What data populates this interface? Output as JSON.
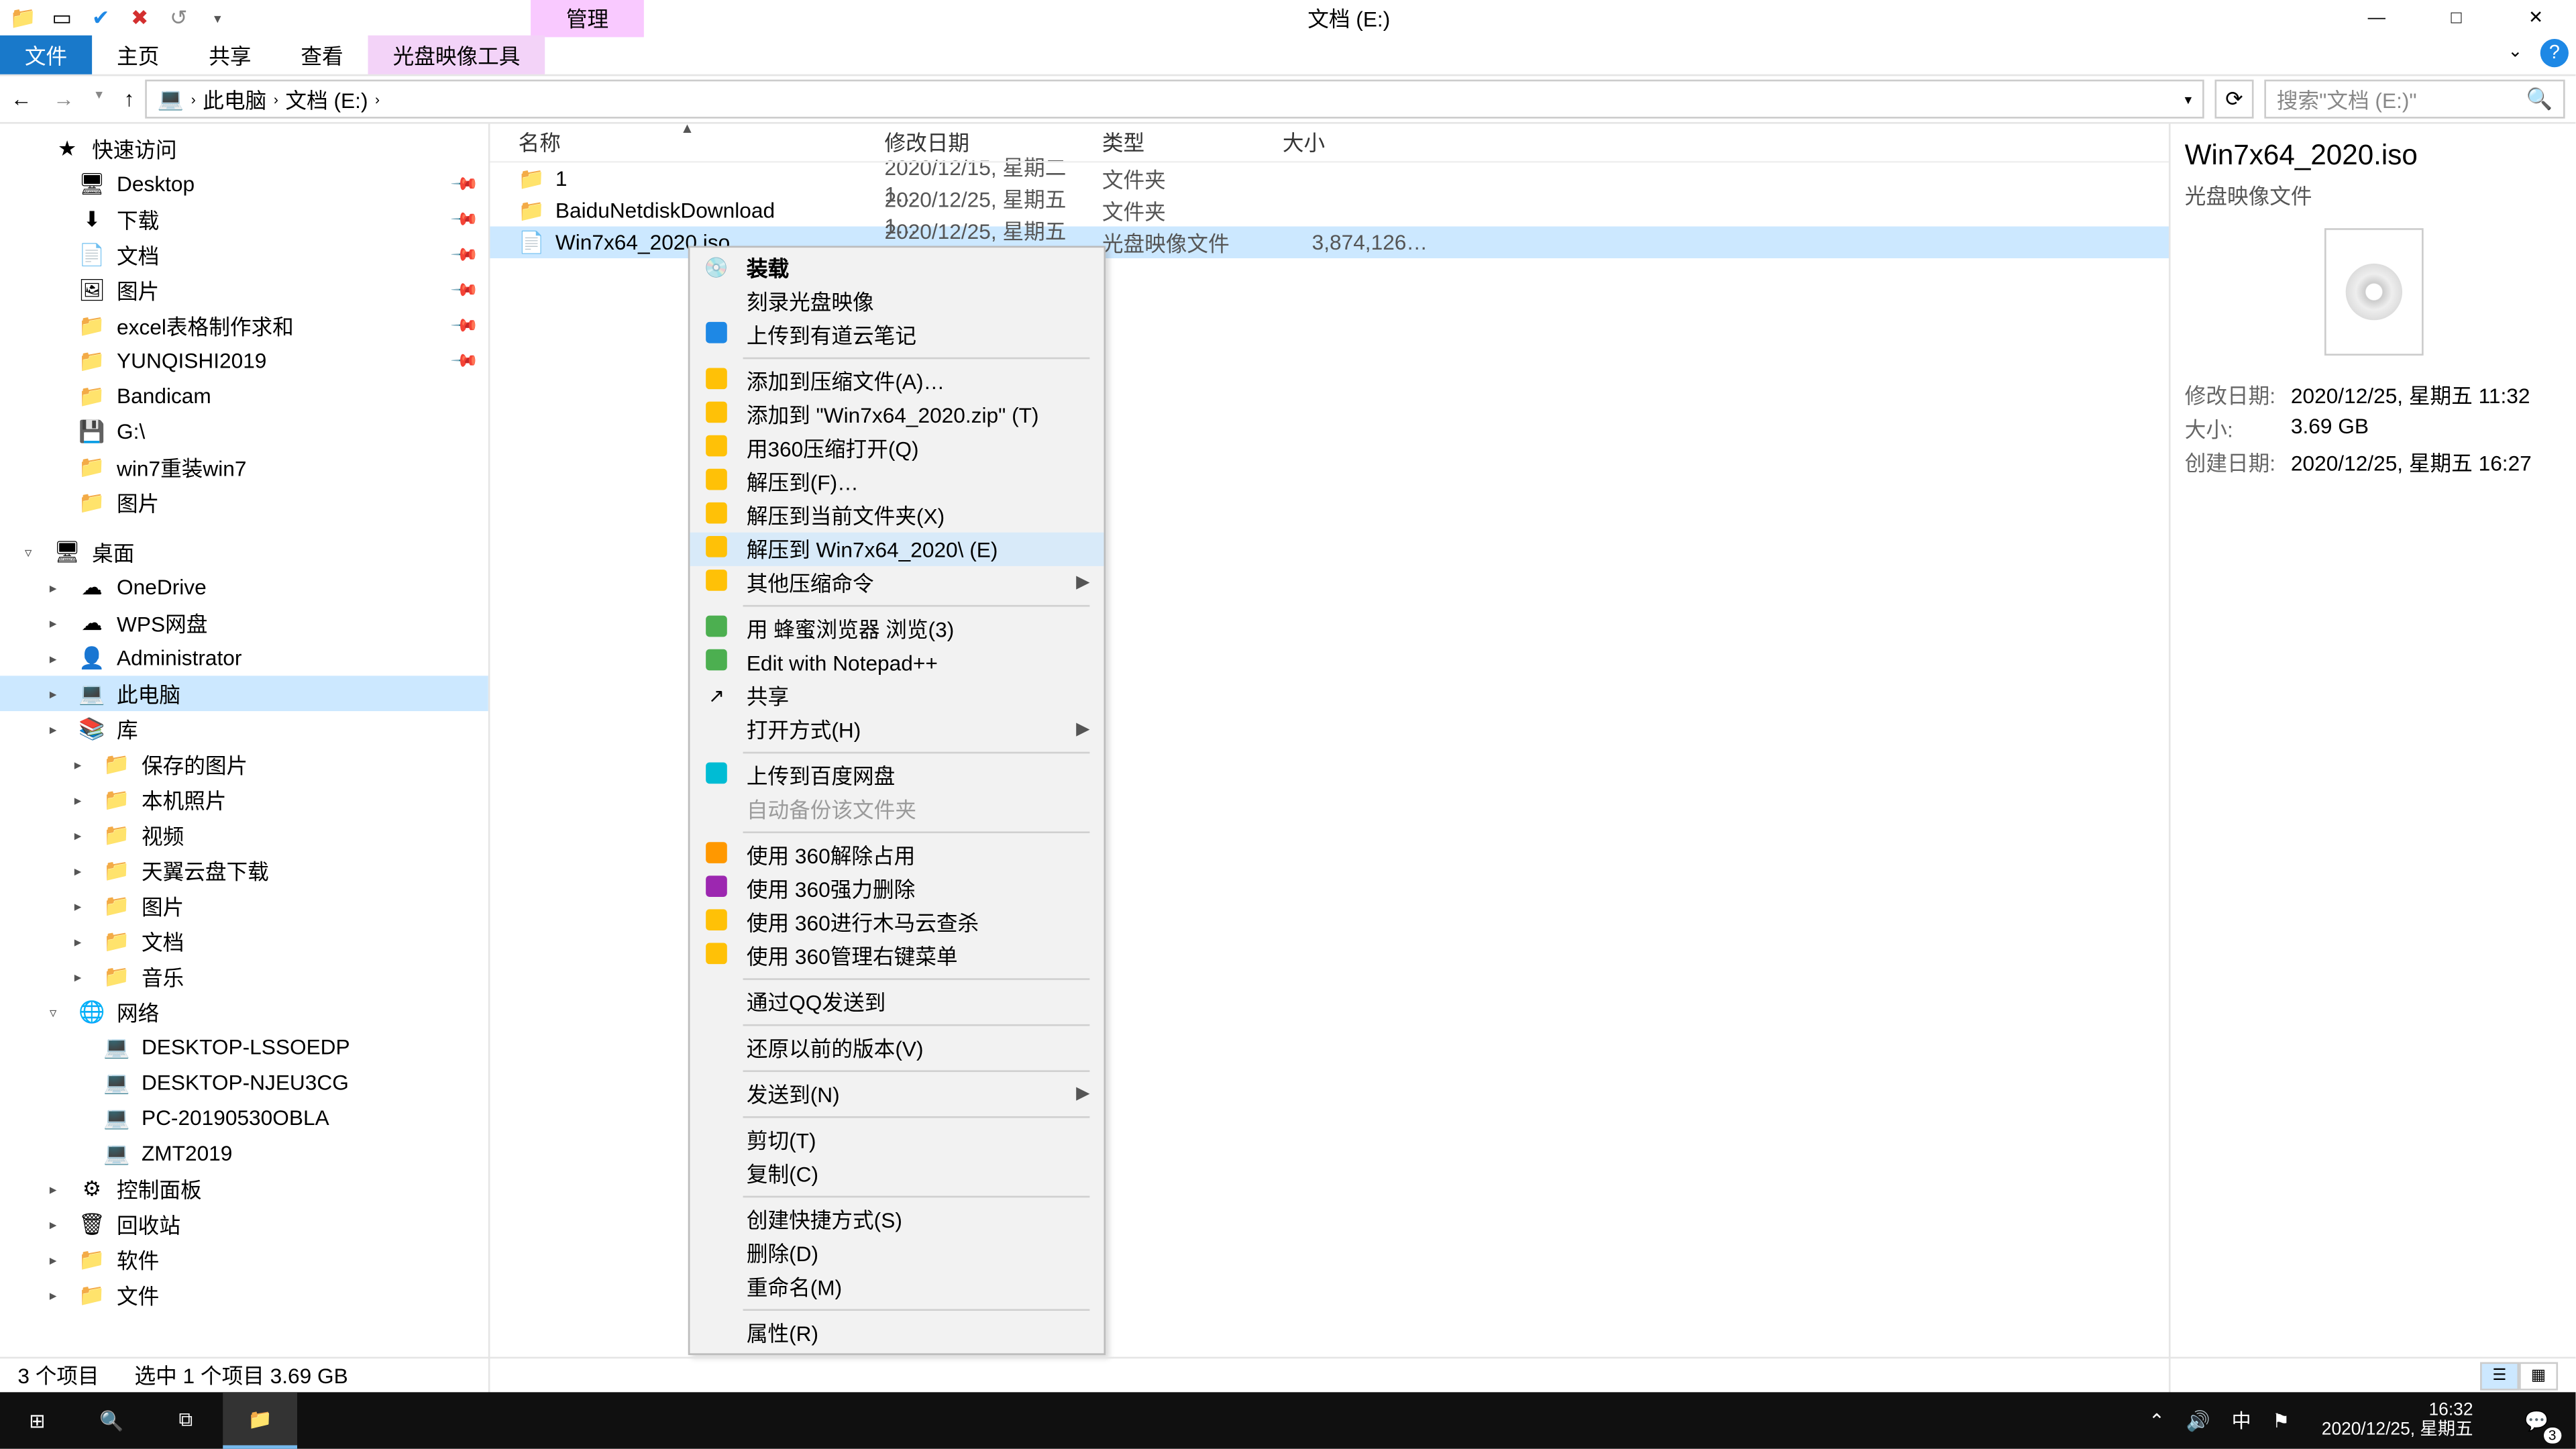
{
  "window": {
    "title": "文档 (E:)",
    "context_tab": "管理",
    "minimize": "—",
    "maximize": "□",
    "close": "✕"
  },
  "ribbon": {
    "file": "文件",
    "tabs": [
      "主页",
      "共享",
      "查看"
    ],
    "context": "光盘映像工具"
  },
  "nav": {
    "back": "←",
    "forward": "→",
    "up": "↑",
    "crumbs": [
      "此电脑",
      "文档 (E:)"
    ],
    "search_placeholder": "搜索\"文档 (E:)\"",
    "refresh": "⟳"
  },
  "tree": {
    "quick_access": {
      "label": "快速访问",
      "icon": "★"
    },
    "quick_items": [
      {
        "label": "Desktop",
        "icon": "🖥",
        "pin": true
      },
      {
        "label": "下载",
        "icon": "⬇",
        "pin": true
      },
      {
        "label": "文档",
        "icon": "📄",
        "pin": true
      },
      {
        "label": "图片",
        "icon": "🖼",
        "pin": true
      },
      {
        "label": "excel表格制作求和",
        "icon": "📁",
        "pin": true
      },
      {
        "label": "YUNQISHI2019",
        "icon": "📁",
        "pin": true
      },
      {
        "label": "Bandicam",
        "icon": "📁"
      },
      {
        "label": "G:\\",
        "icon": "💾"
      },
      {
        "label": "win7重装win7",
        "icon": "📁"
      },
      {
        "label": "图片",
        "icon": "📁"
      }
    ],
    "desktop": {
      "label": "桌面",
      "icon": "🖥"
    },
    "desktop_items": [
      {
        "label": "OneDrive",
        "icon": "☁"
      },
      {
        "label": "WPS网盘",
        "icon": "☁"
      },
      {
        "label": "Administrator",
        "icon": "👤"
      },
      {
        "label": "此电脑",
        "icon": "💻",
        "selected": true
      },
      {
        "label": "库",
        "icon": "📚"
      }
    ],
    "library_items": [
      {
        "label": "保存的图片",
        "icon": "📁"
      },
      {
        "label": "本机照片",
        "icon": "📁"
      },
      {
        "label": "视频",
        "icon": "📁"
      },
      {
        "label": "天翼云盘下载",
        "icon": "📁"
      },
      {
        "label": "图片",
        "icon": "📁"
      },
      {
        "label": "文档",
        "icon": "📁"
      },
      {
        "label": "音乐",
        "icon": "📁"
      }
    ],
    "network": {
      "label": "网络",
      "icon": "🌐"
    },
    "network_items": [
      {
        "label": "DESKTOP-LSSOEDP",
        "icon": "💻"
      },
      {
        "label": "DESKTOP-NJEU3CG",
        "icon": "💻"
      },
      {
        "label": "PC-20190530OBLA",
        "icon": "💻"
      },
      {
        "label": "ZMT2019",
        "icon": "💻"
      }
    ],
    "bottom_items": [
      {
        "label": "控制面板",
        "icon": "⚙"
      },
      {
        "label": "回收站",
        "icon": "🗑"
      },
      {
        "label": "软件",
        "icon": "📁"
      },
      {
        "label": "文件",
        "icon": "📁"
      }
    ]
  },
  "columns": {
    "name": "名称",
    "modified": "修改日期",
    "type": "类型",
    "size": "大小"
  },
  "files": [
    {
      "name": "1",
      "modified": "2020/12/15, 星期二 1…",
      "type": "文件夹",
      "size": "",
      "icon": "folder"
    },
    {
      "name": "BaiduNetdiskDownload",
      "modified": "2020/12/25, 星期五 1…",
      "type": "文件夹",
      "size": "",
      "icon": "folder"
    },
    {
      "name": "Win7x64_2020.iso",
      "modified": "2020/12/25, 星期五 1…",
      "type": "光盘映像文件",
      "size": "3,874,126…",
      "icon": "file",
      "selected": true
    }
  ],
  "context_menu": [
    {
      "label": "装载",
      "icon": "disc",
      "bold": true
    },
    {
      "label": "刻录光盘映像"
    },
    {
      "label": "上传到有道云笔记",
      "icon": "blue"
    },
    {
      "sep": true
    },
    {
      "label": "添加到压缩文件(A)…",
      "icon": "yellow"
    },
    {
      "label": "添加到 \"Win7x64_2020.zip\" (T)",
      "icon": "yellow"
    },
    {
      "label": "用360压缩打开(Q)",
      "icon": "yellow"
    },
    {
      "label": "解压到(F)…",
      "icon": "yellow"
    },
    {
      "label": "解压到当前文件夹(X)",
      "icon": "yellow"
    },
    {
      "label": "解压到 Win7x64_2020\\ (E)",
      "icon": "yellow",
      "highlighted": true
    },
    {
      "label": "其他压缩命令",
      "icon": "yellow",
      "sub": true
    },
    {
      "sep": true
    },
    {
      "label": "用 蜂蜜浏览器 浏览(3)",
      "icon": "green"
    },
    {
      "label": "Edit with Notepad++",
      "icon": "green"
    },
    {
      "label": "共享",
      "icon": "share"
    },
    {
      "label": "打开方式(H)",
      "sub": true
    },
    {
      "sep": true
    },
    {
      "label": "上传到百度网盘",
      "icon": "cyan"
    },
    {
      "label": "自动备份该文件夹",
      "disabled": true
    },
    {
      "sep": true
    },
    {
      "label": "使用 360解除占用",
      "icon": "orange"
    },
    {
      "label": "使用 360强力删除",
      "icon": "purple"
    },
    {
      "label": "使用 360进行木马云查杀",
      "icon": "yellow"
    },
    {
      "label": "使用 360管理右键菜单",
      "icon": "yellow"
    },
    {
      "sep": true
    },
    {
      "label": "通过QQ发送到"
    },
    {
      "sep": true
    },
    {
      "label": "还原以前的版本(V)"
    },
    {
      "sep": true
    },
    {
      "label": "发送到(N)",
      "sub": true
    },
    {
      "sep": true
    },
    {
      "label": "剪切(T)"
    },
    {
      "label": "复制(C)"
    },
    {
      "sep": true
    },
    {
      "label": "创建快捷方式(S)"
    },
    {
      "label": "删除(D)"
    },
    {
      "label": "重命名(M)"
    },
    {
      "sep": true
    },
    {
      "label": "属性(R)"
    }
  ],
  "details": {
    "title": "Win7x64_2020.iso",
    "subtitle": "光盘映像文件",
    "rows": [
      {
        "label": "修改日期:",
        "value": "2020/12/25, 星期五 11:32"
      },
      {
        "label": "大小:",
        "value": "3.69 GB"
      },
      {
        "label": "创建日期:",
        "value": "2020/12/25, 星期五 16:27"
      }
    ]
  },
  "status": {
    "count": "3 个项目",
    "selection": "选中 1 个项目  3.69 GB"
  },
  "taskbar": {
    "ime": "中",
    "time": "16:32",
    "date": "2020/12/25, 星期五",
    "notif_count": "3"
  }
}
